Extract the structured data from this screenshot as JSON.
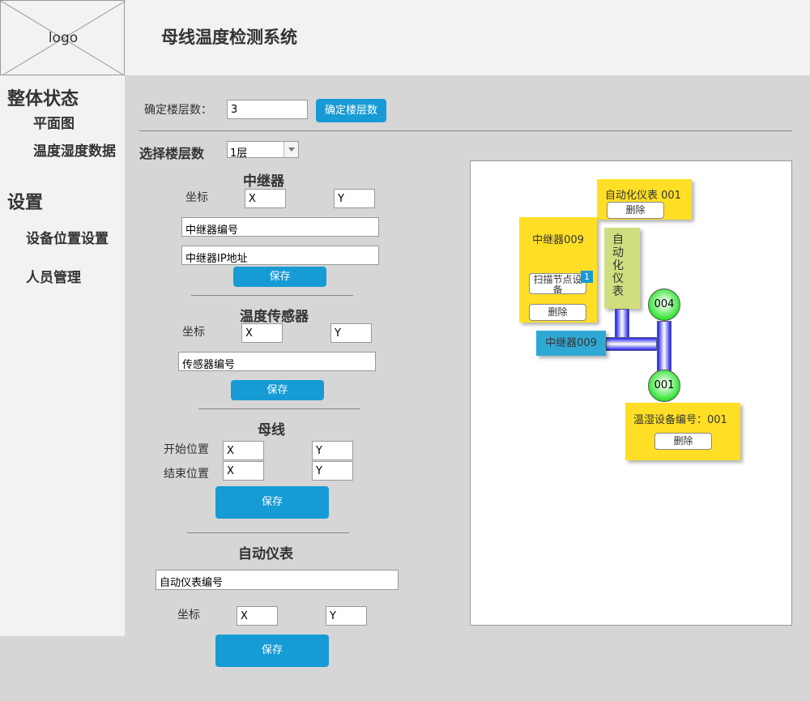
{
  "header": {
    "logo_text": "logo",
    "title": "母线温度检测系统"
  },
  "sidebar": {
    "status_heading": "整体状态",
    "floor_plan": "平面图",
    "temp_humidity": "温度湿度数据",
    "settings_heading": "设置",
    "device_position": "设备位置设置",
    "personnel": "人员管理"
  },
  "floor_count": {
    "label": "确定楼层数：",
    "value": "3",
    "button": "确定楼层数"
  },
  "floor_select": {
    "label": "选择楼层数",
    "selected": "1层"
  },
  "repeater": {
    "title": "中继器",
    "coord_label": "坐标",
    "x_placeholder": "X",
    "y_placeholder": "Y",
    "id_placeholder": "中继器编号",
    "ip_placeholder": "中继器IP地址",
    "save": "保存"
  },
  "temp_sensor": {
    "title": "温度传感器",
    "coord_label": "坐标",
    "x_placeholder": "X",
    "y_placeholder": "Y",
    "id_placeholder": "传感器编号",
    "save": "保存"
  },
  "busbar": {
    "title": "母线",
    "start_label": "开始位置",
    "end_label": "结束位置",
    "x_placeholder": "X",
    "y_placeholder": "Y",
    "save": "保存"
  },
  "auto_meter": {
    "title": "自动仪表",
    "id_placeholder": "自动仪表编号",
    "coord_label": "坐标",
    "x_placeholder": "X",
    "y_placeholder": "Y",
    "save": "保存"
  },
  "canvas": {
    "meter_note": {
      "text": "自动化仪表 001",
      "delete": "删除"
    },
    "repeater_note": {
      "title": "中继器009",
      "scan": "扫描节点设备",
      "badge": "1",
      "delete": "删除"
    },
    "meter_vertical_label": "自动化仪表",
    "repeater_tag": "中继器009",
    "node_top": "004",
    "node_bottom": "001",
    "th_note": {
      "text": "温湿设备编号：001",
      "delete": "删除"
    }
  },
  "colors": {
    "accent": "#169bd5",
    "note": "#ffdf25",
    "meter_label": "#cfdf7f",
    "repeater_tag": "#2fa9d3",
    "pipe": "#1e1ef0"
  }
}
